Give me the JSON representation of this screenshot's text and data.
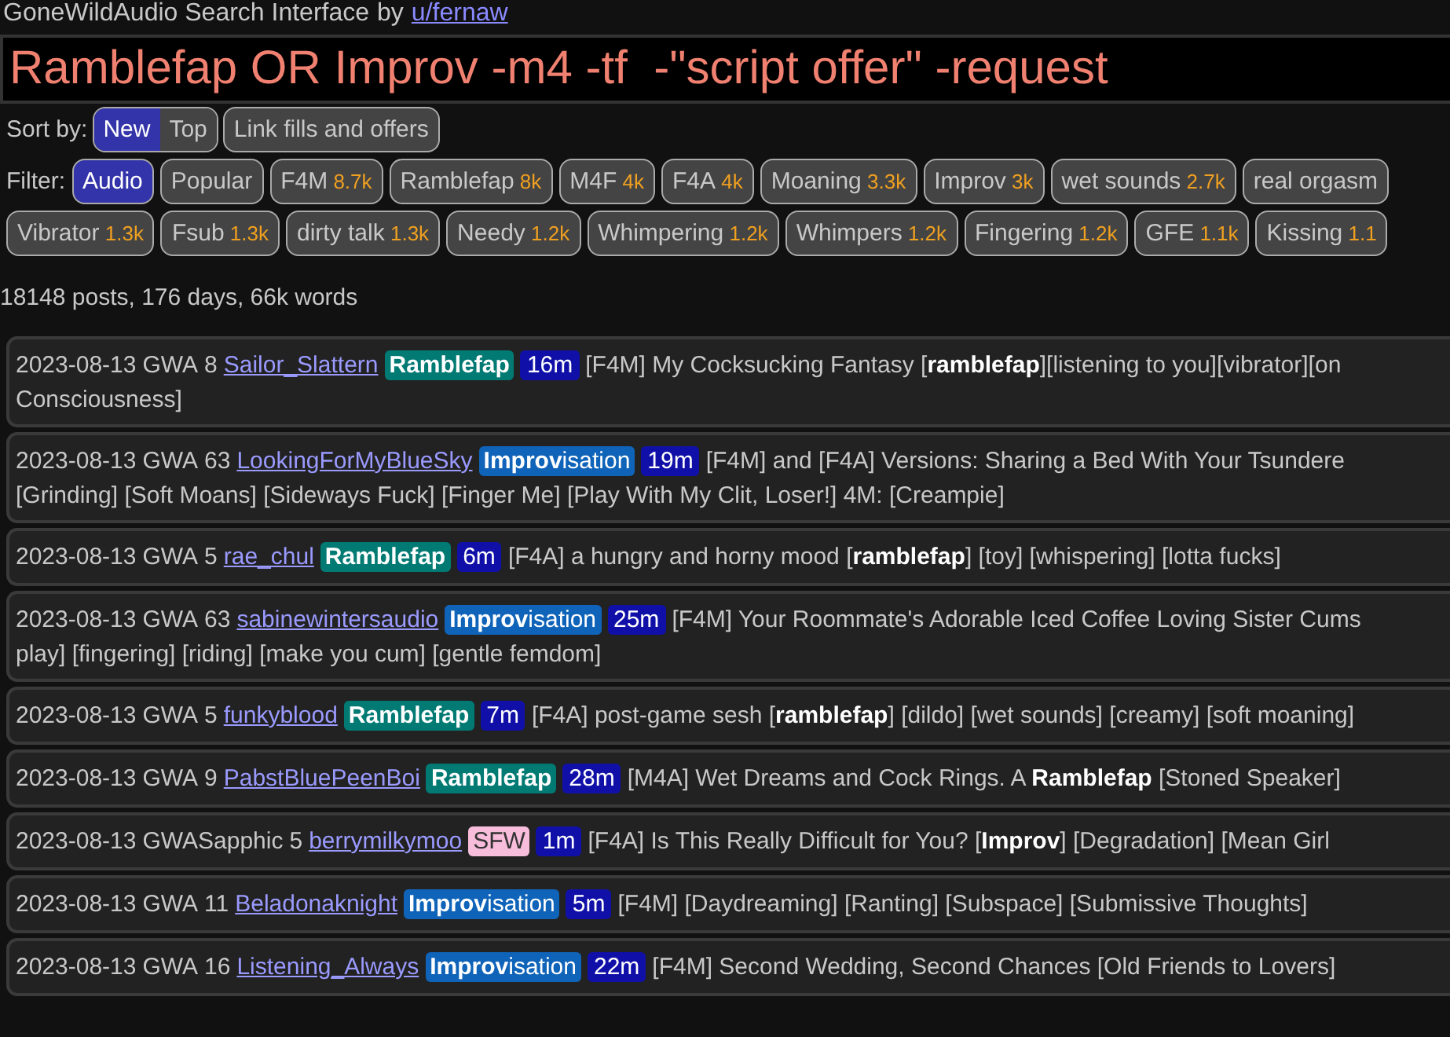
{
  "header": {
    "title": "GoneWildAudio Search Interface",
    "by": "by",
    "author": "u/fernaw"
  },
  "search": {
    "value": "Ramblefap OR Improv -m4 -tf  -\"script offer\" -request"
  },
  "sort": {
    "label": "Sort by:",
    "options": [
      {
        "label": "New",
        "selected": true
      },
      {
        "label": "Top",
        "selected": false
      }
    ],
    "extra_button": "Link fills and offers"
  },
  "filter": {
    "label": "Filter:",
    "chips": [
      {
        "label": "Audio",
        "selected": true
      },
      {
        "label": "Popular",
        "selected": false
      },
      {
        "label": "F4M",
        "count": "8.7k",
        "selected": false
      },
      {
        "label": "Ramblefap",
        "count": "8k",
        "selected": false
      },
      {
        "label": "M4F",
        "count": "4k",
        "selected": false
      },
      {
        "label": "F4A",
        "count": "4k",
        "selected": false
      },
      {
        "label": "Moaning",
        "count": "3.3k",
        "selected": false
      },
      {
        "label": "Improv",
        "count": "3k",
        "selected": false
      },
      {
        "label": "wet sounds",
        "count": "2.7k",
        "selected": false
      },
      {
        "label": "real orgasm",
        "selected": false
      },
      {
        "label": "Vibrator",
        "count": "1.3k",
        "selected": false
      },
      {
        "label": "Fsub",
        "count": "1.3k",
        "selected": false
      },
      {
        "label": "dirty talk",
        "count": "1.3k",
        "selected": false
      },
      {
        "label": "Needy",
        "count": "1.2k",
        "selected": false
      },
      {
        "label": "Whimpering",
        "count": "1.2k",
        "selected": false
      },
      {
        "label": "Whimpers",
        "count": "1.2k",
        "selected": false
      },
      {
        "label": "Fingering",
        "count": "1.2k",
        "selected": false
      },
      {
        "label": "GFE",
        "count": "1.1k",
        "selected": false
      },
      {
        "label": "Kissing",
        "count": "1.1",
        "selected": false
      }
    ]
  },
  "stats": "18148 posts, 176 days, 66k words",
  "posts": [
    {
      "date": "2023-08-13",
      "sub": "GWA",
      "score": "8",
      "author": "Sailor_Slattern",
      "flair": {
        "kind": "ramblefap",
        "text": "Ramblefap"
      },
      "duration": "16m",
      "title_lines": [
        "[F4M] My Cocksucking Fantasy [**ramblefap**][listening to you][vibrator][on",
        "Consciousness]"
      ]
    },
    {
      "date": "2023-08-13",
      "sub": "GWA",
      "score": "63",
      "author": "LookingForMyBlueSky",
      "flair": {
        "kind": "improv",
        "text": "**Improv**isation"
      },
      "duration": "19m",
      "title_lines": [
        "[F4M] and [F4A] Versions: Sharing a Bed With Your Tsundere",
        "[Grinding] [Soft Moans] [Sideways Fuck] [Finger Me] [Play With My Clit, Loser!] 4M: [Creampie]"
      ]
    },
    {
      "date": "2023-08-13",
      "sub": "GWA",
      "score": "5",
      "author": "rae_chul",
      "flair": {
        "kind": "ramblefap",
        "text": "Ramblefap"
      },
      "duration": "6m",
      "title_lines": [
        "[F4A] a hungry and horny mood [**ramblefap**] [toy] [whispering] [lotta fucks]"
      ]
    },
    {
      "date": "2023-08-13",
      "sub": "GWA",
      "score": "63",
      "author": "sabinewintersaudio",
      "flair": {
        "kind": "improv",
        "text": "**Improv**isation"
      },
      "duration": "25m",
      "title_lines": [
        "[F4M] Your Roommate's Adorable Iced Coffee Loving Sister Cums",
        "play] [fingering] [riding] [make you cum] [gentle femdom]"
      ]
    },
    {
      "date": "2023-08-13",
      "sub": "GWA",
      "score": "5",
      "author": "funkyblood",
      "flair": {
        "kind": "ramblefap",
        "text": "Ramblefap"
      },
      "duration": "7m",
      "title_lines": [
        "[F4A] post-game sesh [**ramblefap**] [dildo] [wet sounds] [creamy] [soft moaning]"
      ]
    },
    {
      "date": "2023-08-13",
      "sub": "GWA",
      "score": "9",
      "author": "PabstBluePeenBoi",
      "flair": {
        "kind": "ramblefap",
        "text": "Ramblefap"
      },
      "duration": "28m",
      "title_lines": [
        "[M4A] Wet Dreams and Cock Rings. A **Ramblefap** [Stoned Speaker]"
      ]
    },
    {
      "date": "2023-08-13",
      "sub": "GWASapphic",
      "score": "5",
      "author": "berrymilkymoo",
      "flair": {
        "kind": "sfw",
        "text": "SFW"
      },
      "duration": "1m",
      "title_lines": [
        "[F4A] Is This Really Difficult for You? [**Improv**] [Degradation] [Mean Girl"
      ]
    },
    {
      "date": "2023-08-13",
      "sub": "GWA",
      "score": "11",
      "author": "Beladonaknight",
      "flair": {
        "kind": "improv",
        "text": "**Improv**isation"
      },
      "duration": "5m",
      "title_lines": [
        "[F4M] [Daydreaming] [Ranting] [Subspace] [Submissive Thoughts]"
      ]
    },
    {
      "date": "2023-08-13",
      "sub": "GWA",
      "score": "16",
      "author": "Listening_Always",
      "flair": {
        "kind": "improv",
        "text": "**Improv**isation"
      },
      "duration": "22m",
      "title_lines": [
        "[F4M] Second Wedding, Second Chances [Old Friends to Lovers]"
      ]
    }
  ]
}
